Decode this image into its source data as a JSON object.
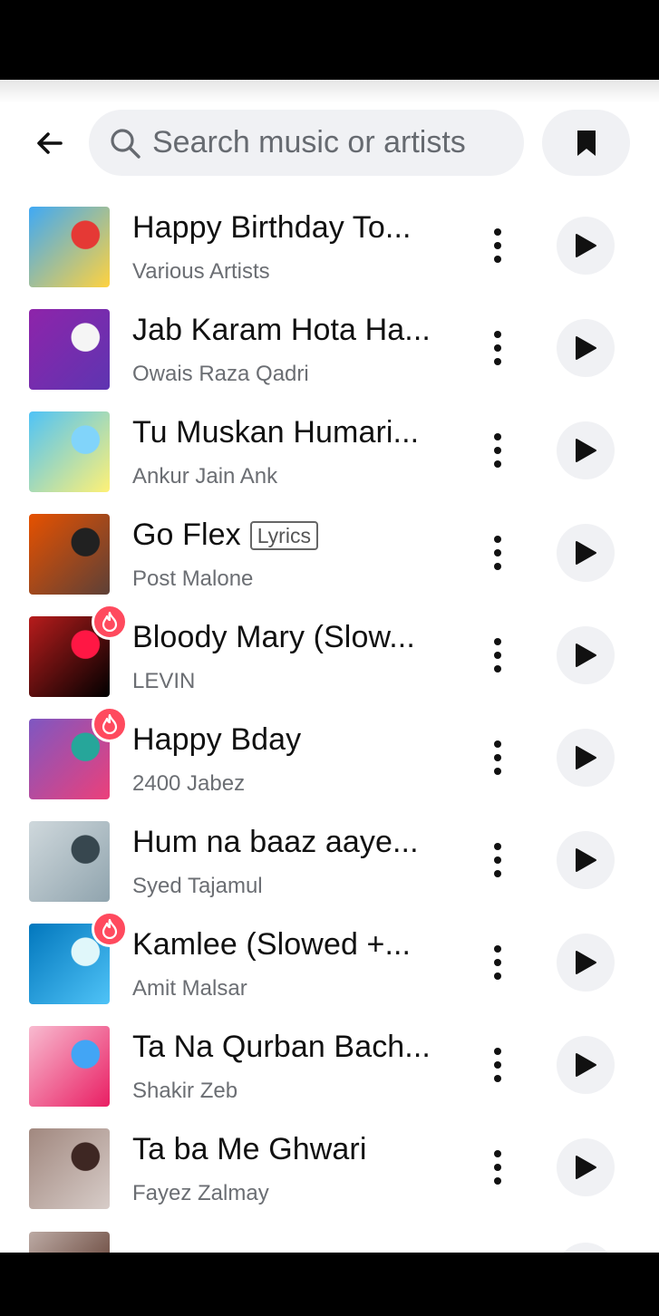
{
  "search": {
    "placeholder": "Search music or artists",
    "value": ""
  },
  "icons": {
    "back": "arrow-left-icon",
    "search": "search-icon",
    "bookmark": "bookmark-icon",
    "more": "more-vertical-icon",
    "play": "play-icon",
    "hot": "flame-icon"
  },
  "colors": {
    "hot_badge": "#ff4a5e",
    "button_bg": "#f0f1f4",
    "artist_text": "#6b6e73"
  },
  "songs": [
    {
      "title": "Happy Birthday To...",
      "artist": "Various Artists",
      "hot": false,
      "lyrics": "",
      "thumb_colors": [
        "#3fa9f5",
        "#ffd23f",
        "#e53935"
      ]
    },
    {
      "title": "Jab Karam Hota Ha...",
      "artist": "Owais Raza Qadri",
      "hot": false,
      "lyrics": "",
      "thumb_colors": [
        "#8e24aa",
        "#5e35b1",
        "#f5f5f5"
      ]
    },
    {
      "title": "Tu Muskan Humari...",
      "artist": "Ankur Jain Ank",
      "hot": false,
      "lyrics": "",
      "thumb_colors": [
        "#4fc3f7",
        "#fff176",
        "#81d4fa"
      ]
    },
    {
      "title": "Go Flex",
      "artist": "Post Malone",
      "hot": false,
      "lyrics": "Lyrics",
      "thumb_colors": [
        "#e65100",
        "#5d4037",
        "#212121"
      ]
    },
    {
      "title": "Bloody Mary (Slow...",
      "artist": "LEVIN",
      "hot": true,
      "lyrics": "",
      "thumb_colors": [
        "#b71c1c",
        "#000000",
        "#ff1744"
      ]
    },
    {
      "title": "Happy Bday",
      "artist": "2400 Jabez",
      "hot": true,
      "lyrics": "",
      "thumb_colors": [
        "#7e57c2",
        "#ec407a",
        "#26a69a"
      ]
    },
    {
      "title": "Hum na baaz aaye...",
      "artist": "Syed Tajamul",
      "hot": false,
      "lyrics": "",
      "thumb_colors": [
        "#cfd8dc",
        "#90a4ae",
        "#37474f"
      ]
    },
    {
      "title": "Kamlee (Slowed +...",
      "artist": "Amit Malsar",
      "hot": true,
      "lyrics": "",
      "thumb_colors": [
        "#0277bd",
        "#4fc3f7",
        "#e0f7fa"
      ]
    },
    {
      "title": "Ta Na Qurban Bach...",
      "artist": "Shakir Zeb",
      "hot": false,
      "lyrics": "",
      "thumb_colors": [
        "#f8bbd0",
        "#e91e63",
        "#42a5f5"
      ]
    },
    {
      "title": "Ta ba Me Ghwari",
      "artist": "Fayez Zalmay",
      "hot": false,
      "lyrics": "",
      "thumb_colors": [
        "#a1887f",
        "#d7ccc8",
        "#3e2723"
      ]
    }
  ]
}
